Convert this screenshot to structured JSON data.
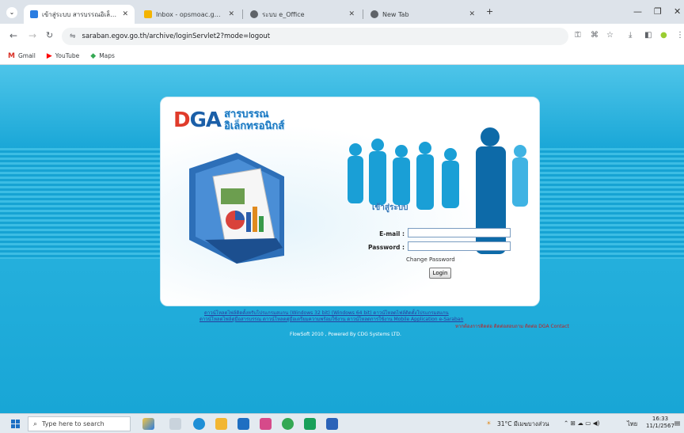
{
  "browser": {
    "tabs": [
      {
        "title": "เข้าสู่ระบบ สารบรรณอิเล็กทรอนิกส์",
        "active": true,
        "favicon_color": "#2a7de1"
      },
      {
        "title": "Inbox - opsmoac.go.th - Smart",
        "active": false,
        "favicon_color": "#f4b400"
      },
      {
        "title": "ระบบ e_Office",
        "active": false,
        "favicon_color": "#5f6368"
      },
      {
        "title": "New Tab",
        "active": false,
        "favicon_color": "#5f6368"
      }
    ],
    "new_tab_symbol": "+",
    "close_symbol": "✕",
    "url": "saraban.egov.go.th/archive/loginServlet2?mode=logout",
    "bookmarks": [
      {
        "label": "Gmail",
        "icon": "gmail-icon",
        "color": "#d93025",
        "glyph": "M"
      },
      {
        "label": "YouTube",
        "icon": "youtube-icon",
        "color": "#ff0000",
        "glyph": "▶"
      },
      {
        "label": "Maps",
        "icon": "maps-icon",
        "color": "#34a853",
        "glyph": "◆"
      }
    ]
  },
  "page": {
    "logo_text": "DGA",
    "site_title_line1": "สารบรรณ",
    "site_title_line2": "อิเล็กทรอนิกส์",
    "login_heading": "เข้าสู่ระบบ",
    "email_label": "E-mail :",
    "email_value": "",
    "password_label": "Password :",
    "password_value": "",
    "change_password": "Change Password",
    "login_button": "Login",
    "download_links_line1": "ดาวน์โหลดไฟล์ติดตั้งหรับโปรแกรมสแกน  (Windows 32 bit)  (Windows 64 bit)   ดาวน์โหลดไฟล์ติดตั้งโปรแกรมสแกน",
    "download_links_line2": "ดาวน์โหลดไฟล์คู่มือสารบรรณ   ดาวน์โหลดคู่มือเตรียมความพร้อมใช้งาน   ดาวน์โหลดการใช้งาน Mobile Application e-Saraban",
    "contact_link": "หากต้องการติดต่อ  ติดต่อสอบถาม  ติดต่อ DGA Contact",
    "footer": "FlowSoft 2010 , Powered By CDG Systems LTD.",
    "accent_color": "#18a6d6"
  },
  "taskbar": {
    "search_placeholder": "Type here to search",
    "weather": "31°C  มีเมฆบางส่วน",
    "language": "ไทย",
    "time": "16:33",
    "date": "11/1/2567"
  }
}
